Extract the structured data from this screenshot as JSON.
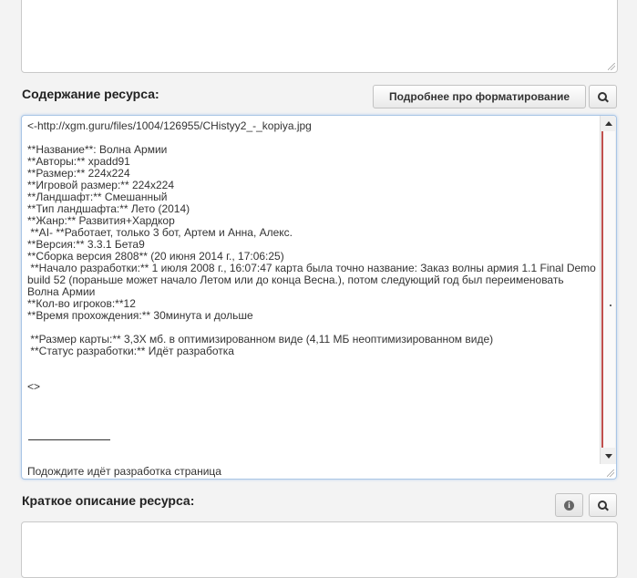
{
  "labels": {
    "content": "Содержание ресурса:",
    "description": "Краткое описание ресурса:"
  },
  "buttons": {
    "formatting": "Подробнее про форматирование",
    "search_icon": "search-icon",
    "info_icon": "info-icon"
  },
  "editor": {
    "lines": [
      "<-http://xgm.guru/files/1004/126955/CHistyy2_-_kopiya.jpg",
      "",
      "**Название**: Волна Армии",
      "**Авторы:** xpadd91",
      "**Размер:** 224x224",
      "**Игровой размер:** 224x224",
      "**Ландшафт:** Смешанный",
      "**Тип ландшафта:** Лето (2014)",
      "**Жанр:** Развития+Хардкор",
      " **AI- **Работает, только 3 бот, Артем и Анна, Алекс.",
      "**Версия:** 3.3.1 Бета9",
      "**Сборка версия 2808** (20 июня 2014 г., 17:06:25)",
      " **Начало разработки:** 1 июля 2008 г., 16:07:47 карта была точно название: Заказ волны армия 1.1 Final Demo build 52 (пораньше может начало Летом или до конца Весна.), потом следующий год был переименовать Волна Армии",
      "**Кол-во игроков:**12",
      "**Время прохождения:** 30минута и дольше",
      "",
      " **Размер карты:** 3,3Х мб. в оптимизированном виде (4,11 МБ неоптимизированном виде)",
      " **Статус разработки:** Идёт разработка",
      "",
      "",
      "<>"
    ],
    "footer": "Подождите идёт разработка страница"
  }
}
